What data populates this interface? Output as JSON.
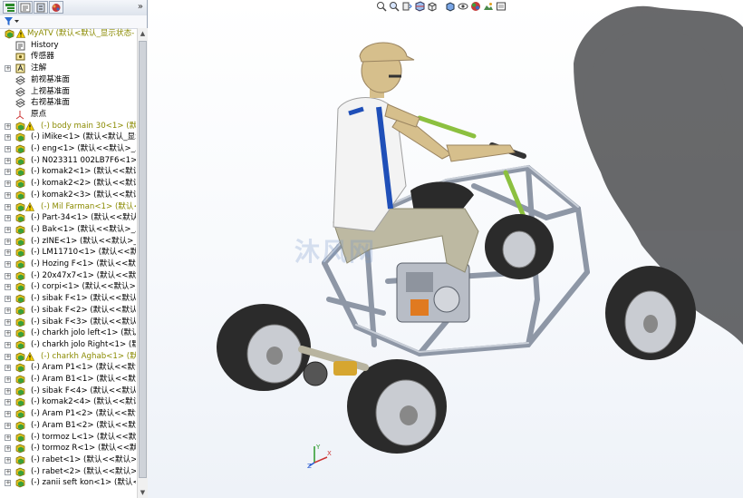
{
  "panel_tabs": [
    {
      "name": "feature-manager-tab",
      "color": "#2a8a2a"
    },
    {
      "name": "property-manager-tab",
      "color": "#6b6b6b"
    },
    {
      "name": "configuration-manager-tab",
      "color": "#6b6b6b"
    },
    {
      "name": "display-manager-tab",
      "color": "#c43a3a"
    }
  ],
  "expand_chevron": "»",
  "filter_icon": "funnel-icon",
  "tree": {
    "root": "MyATV  (默认<默认_显示状态-",
    "items": [
      {
        "label": "History",
        "icon": "history-icon",
        "expand": false,
        "warn": false
      },
      {
        "label": "传感器",
        "icon": "sensor-icon",
        "expand": false,
        "warn": false
      },
      {
        "label": "注解",
        "icon": "annotation-icon",
        "expand": true,
        "warn": false
      },
      {
        "label": "前视基准面",
        "icon": "plane-icon",
        "expand": false,
        "warn": false
      },
      {
        "label": "上视基准面",
        "icon": "plane-icon",
        "expand": false,
        "warn": false
      },
      {
        "label": "右视基准面",
        "icon": "plane-icon",
        "expand": false,
        "warn": false
      },
      {
        "label": "原点",
        "icon": "origin-icon",
        "expand": false,
        "warn": false
      },
      {
        "label": "(-) body main 30<1> (默认",
        "icon": "part-icon",
        "expand": true,
        "warn": true,
        "yellow": true
      },
      {
        "label": "(-) iMike<1> (默认<默认_显示",
        "icon": "part-icon",
        "expand": true,
        "warn": false
      },
      {
        "label": "(-) eng<1> (默认<<默认>_显示",
        "icon": "part-icon",
        "expand": true,
        "warn": false
      },
      {
        "label": "(-) N023311 002LB7F6<1> (默",
        "icon": "part-icon",
        "expand": true,
        "warn": false
      },
      {
        "label": "(-) komak2<1> (默认<<默认>",
        "icon": "part-icon",
        "expand": true,
        "warn": false
      },
      {
        "label": "(-) komak2<2> (默认<<默认>",
        "icon": "part-icon",
        "expand": true,
        "warn": false
      },
      {
        "label": "(-) komak2<3> (默认<<默认>",
        "icon": "part-icon",
        "expand": true,
        "warn": false
      },
      {
        "label": "(-) Mil Farman<1> (默认<",
        "icon": "part-icon",
        "expand": true,
        "warn": true,
        "yellow": true
      },
      {
        "label": "(-) Part-34<1> (默认<<默认>",
        "icon": "part-icon",
        "expand": true,
        "warn": false
      },
      {
        "label": "(-) Bak<1> (默认<<默认>_显示",
        "icon": "part-icon",
        "expand": true,
        "warn": false
      },
      {
        "label": "(-) zINE<1> (默认<<默认>_显",
        "icon": "part-icon",
        "expand": true,
        "warn": false
      },
      {
        "label": "(-) LM11710<1> (默认<<默认>",
        "icon": "part-icon",
        "expand": true,
        "warn": false
      },
      {
        "label": "(-) Hozing F<1> (默认<<默认>",
        "icon": "part-icon",
        "expand": true,
        "warn": false
      },
      {
        "label": "(-) 20x47x7<1> (默认<<默认",
        "icon": "part-icon",
        "expand": true,
        "warn": false
      },
      {
        "label": "(-) corpi<1> (默认<<默认>_显示",
        "icon": "part-icon",
        "expand": true,
        "warn": false
      },
      {
        "label": "(-) sibak F<1> (默认<<默认>_",
        "icon": "part-icon",
        "expand": true,
        "warn": false
      },
      {
        "label": "(-) sibak F<2> (默认<<默认>_",
        "icon": "part-icon",
        "expand": true,
        "warn": false
      },
      {
        "label": "(-) sibak F<3> (默认<<默认>_",
        "icon": "part-icon",
        "expand": true,
        "warn": false
      },
      {
        "label": "(-) charkh jolo left<1> (默认",
        "icon": "part-icon",
        "expand": true,
        "warn": false
      },
      {
        "label": "(-) charkh jolo Right<1> (默认",
        "icon": "part-icon",
        "expand": true,
        "warn": false
      },
      {
        "label": "(-) charkh Aghab<1> (默认",
        "icon": "part-icon",
        "expand": true,
        "warn": true,
        "yellow": true
      },
      {
        "label": "(-) Aram P1<1> (默认<<默认>",
        "icon": "part-icon",
        "expand": true,
        "warn": false
      },
      {
        "label": "(-) Aram B1<1> (默认<<默认>",
        "icon": "part-icon",
        "expand": true,
        "warn": false
      },
      {
        "label": "(-) sibak F<4> (默认<<默认>_",
        "icon": "part-icon",
        "expand": true,
        "warn": false
      },
      {
        "label": "(-) komak2<4> (默认<<默认>",
        "icon": "part-icon",
        "expand": true,
        "warn": false
      },
      {
        "label": "(-) Aram P1<2> (默认<<默认>",
        "icon": "part-icon",
        "expand": true,
        "warn": false
      },
      {
        "label": "(-) Aram B1<2> (默认<<默认>",
        "icon": "part-icon",
        "expand": true,
        "warn": false
      },
      {
        "label": "(-) tormoz L<1> (默认<<默认>",
        "icon": "part-icon",
        "expand": true,
        "warn": false
      },
      {
        "label": "(-) tormoz R<1> (默认<<默认>",
        "icon": "part-icon",
        "expand": true,
        "warn": false
      },
      {
        "label": "(-) rabet<1> (默认<<默认>_显",
        "icon": "part-icon",
        "expand": true,
        "warn": false
      },
      {
        "label": "(-) rabet<2> (默认<<默认>_显",
        "icon": "part-icon",
        "expand": true,
        "warn": false
      },
      {
        "label": "(-) zanii seft kon<1> (默认<",
        "icon": "part-icon",
        "expand": true,
        "warn": false
      }
    ]
  },
  "heads_up_toolbar": [
    "zoom-to-fit-icon",
    "zoom-to-area-icon",
    "previous-view-icon",
    "section-view-icon",
    "view-orientation-icon",
    "display-style-icon",
    "hide-show-items-icon",
    "edit-appearance-icon",
    "apply-scene-icon",
    "view-settings-icon"
  ],
  "watermark": "沐风网",
  "triad": {
    "x_label": "X",
    "y_label": "Y",
    "z_label": "Z"
  },
  "colors": {
    "tree_yellow": "#8a8a00",
    "part_green": "#2f8f2f",
    "tire": "#2b2b2b",
    "rim": "#c9ccd2",
    "frame": "#9aa3b0",
    "rider_shirt": "#f3f3f3",
    "rider_stripe": "#1f4fb8",
    "rider_pants": "#bdb9a2",
    "skin": "#d6bf8c"
  }
}
